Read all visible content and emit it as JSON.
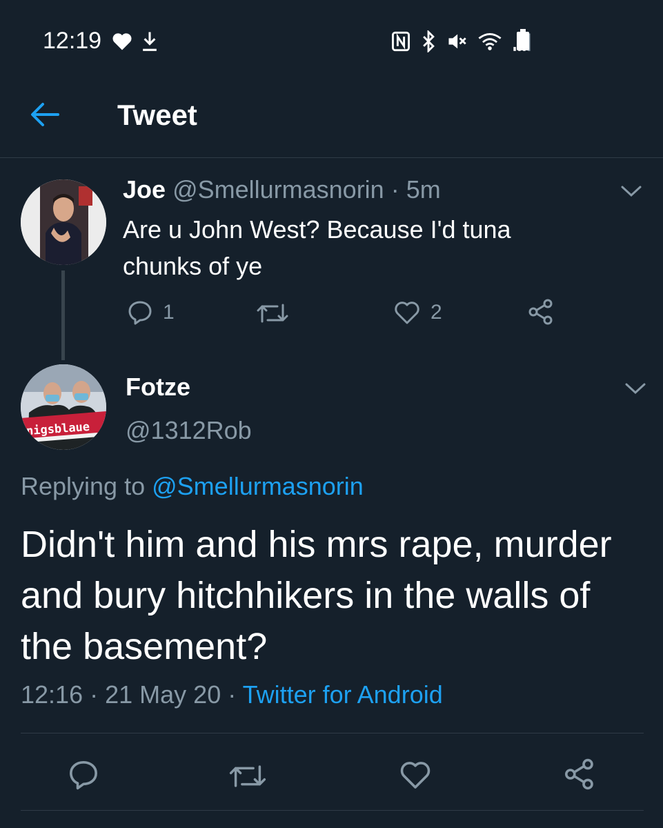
{
  "status_bar": {
    "time": "12:19",
    "icons_left": [
      "heart-icon",
      "download-icon"
    ],
    "icons_right": [
      "nfc-icon",
      "bluetooth-icon",
      "mute-icon",
      "wifi-icon",
      "signal-icon",
      "battery-icon"
    ]
  },
  "header": {
    "title": "Tweet",
    "back_icon": "arrow-left-icon"
  },
  "tweet1": {
    "author_name": "Joe",
    "author_handle": "@Smellurmasnorin",
    "separator": "·",
    "time": "5m",
    "text": "Are u John West? Because I'd tuna chunks of ye",
    "replies": "1",
    "retweets": "",
    "likes": "2"
  },
  "tweet2": {
    "author_name": "Fotze",
    "author_handle": "@1312Rob",
    "replying_label": "Replying to",
    "replying_to": "@Smellurmasnorin",
    "text": "Didn't him and his mrs rape, murder and bury hitchhikers in the walls of the basement?",
    "time": "12:16",
    "date": "21 May 20",
    "source": "Twitter for Android",
    "separator": "·",
    "avatar_banner_text": "nigsblaue"
  },
  "colors": {
    "background": "#15202b",
    "accent": "#1da1f2",
    "muted": "#8899a6",
    "divider": "#2f3b47"
  }
}
